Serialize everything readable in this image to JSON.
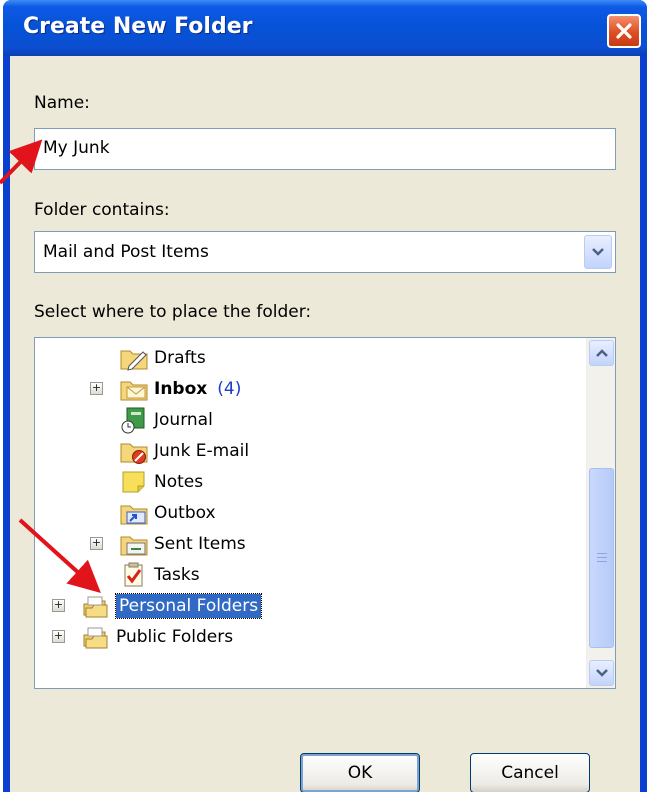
{
  "window": {
    "title": "Create New Folder",
    "close_icon": "close-icon"
  },
  "name_field": {
    "label": "Name:",
    "value": "My Junk"
  },
  "folder_contains": {
    "label": "Folder contains:",
    "selected": "Mail and Post Items"
  },
  "tree": {
    "label": "Select where to place the folder:",
    "items": [
      {
        "label": "Drafts",
        "icon": "drafts-folder-icon"
      },
      {
        "label": "Inbox",
        "count": "(4)",
        "icon": "inbox-folder-icon",
        "bold": true,
        "expandable": true
      },
      {
        "label": "Journal",
        "icon": "journal-icon"
      },
      {
        "label": "Junk E-mail",
        "icon": "junk-email-folder-icon"
      },
      {
        "label": "Notes",
        "icon": "notes-icon"
      },
      {
        "label": "Outbox",
        "icon": "outbox-folder-icon"
      },
      {
        "label": "Sent Items",
        "icon": "sent-items-folder-icon",
        "expandable": true
      },
      {
        "label": "Tasks",
        "icon": "tasks-icon"
      },
      {
        "label": "Personal Folders",
        "icon": "personal-folders-icon",
        "expandable": true,
        "selected": true
      },
      {
        "label": "Public Folders",
        "icon": "public-folders-icon",
        "expandable": true
      }
    ]
  },
  "buttons": {
    "ok": "OK",
    "cancel": "Cancel"
  },
  "colors": {
    "title_bar": "#0552d6",
    "selection": "#316ac5",
    "arrow": "#e0141a",
    "dialog_bg": "#ece9d8"
  }
}
